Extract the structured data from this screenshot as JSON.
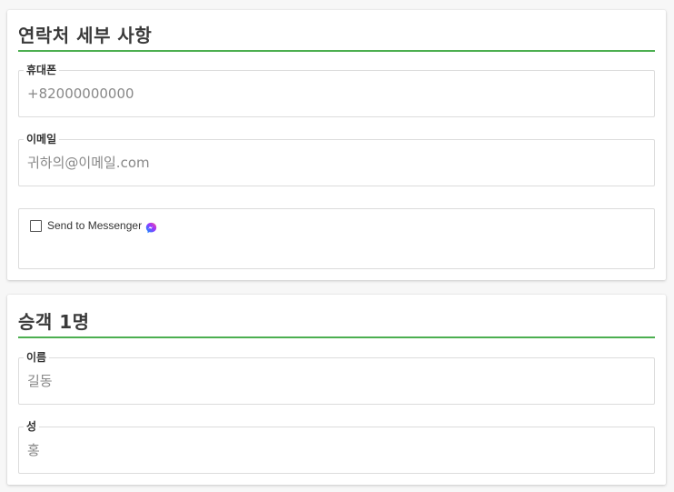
{
  "contact": {
    "title": "연락처 세부 사항",
    "phone": {
      "label": "휴대폰",
      "placeholder": "+82000000000"
    },
    "email": {
      "label": "이메일",
      "placeholder": "귀하의@이메일.com"
    },
    "messenger": {
      "label": "Send to Messenger",
      "icon": "messenger-icon",
      "checked": false
    }
  },
  "passenger": {
    "title": "승객 1명",
    "first_name": {
      "label": "이름",
      "placeholder": "길동"
    },
    "last_name": {
      "label": "성",
      "placeholder": "홍"
    }
  },
  "colors": {
    "accent_rule": "#4caf50",
    "messenger_gradient_start": "#0099ff",
    "messenger_gradient_end": "#a033ff"
  }
}
